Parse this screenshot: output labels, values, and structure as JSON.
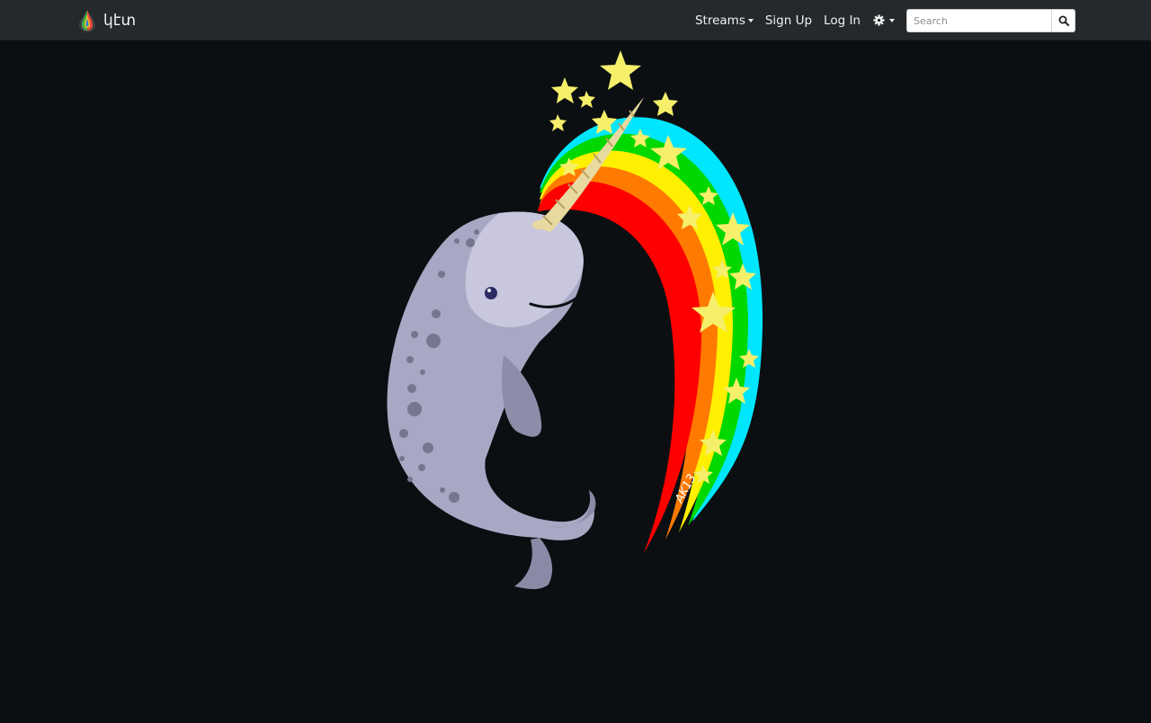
{
  "brand": {
    "name": "կէտ"
  },
  "nav": {
    "streams_label": "Streams",
    "signup_label": "Sign Up",
    "login_label": "Log In"
  },
  "search": {
    "placeholder": "Search"
  },
  "icons": {
    "logo": "drop-logo-icon",
    "settings": "gear-icon",
    "search": "search-icon"
  },
  "illustration": {
    "subject": "narwhal-with-rainbow",
    "signature": "AK13"
  },
  "colors": {
    "navbar_bg": "#25292c",
    "page_bg": "#0b0f12",
    "rainbow": [
      "#ff0000",
      "#ff7a00",
      "#ffef00",
      "#00d800",
      "#00e6ff"
    ],
    "star": "#f6ef6a",
    "narwhal": "#a9a8c4"
  }
}
